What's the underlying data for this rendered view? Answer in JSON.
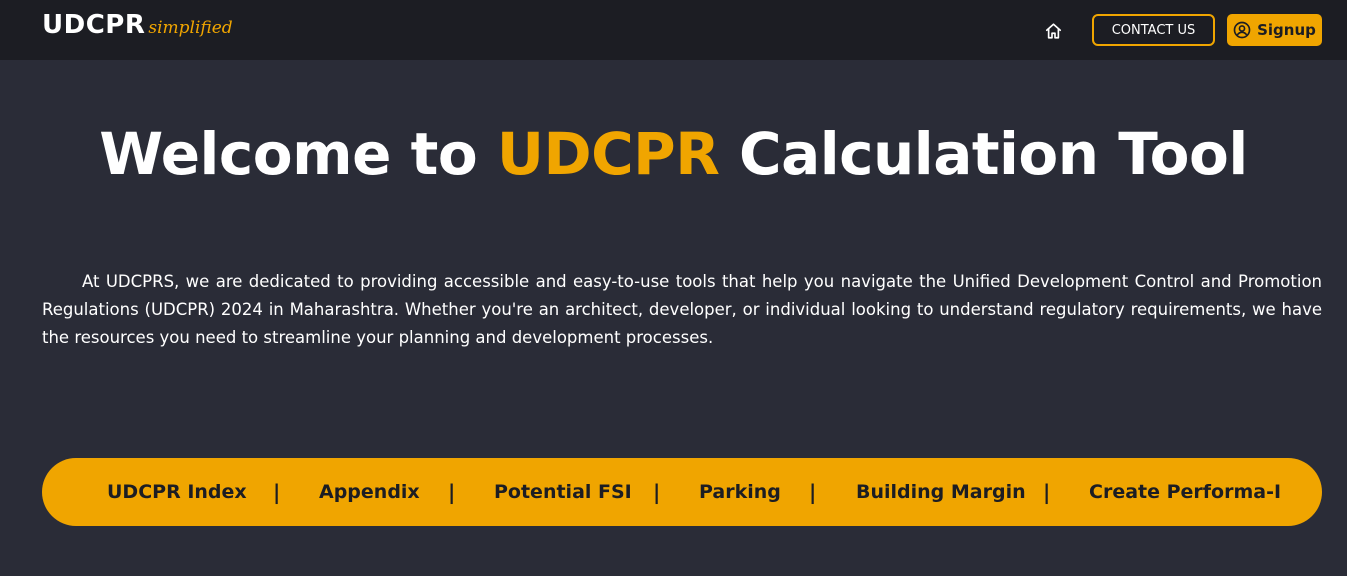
{
  "navbar": {
    "brand_main": "UDCPR",
    "brand_sub": "simplified",
    "home_icon": "home-icon",
    "contact_label": "CONTACT US",
    "signup_label": "Signup",
    "signup_icon": "user-circle-icon",
    "accent_color": "#f0a500"
  },
  "hero": {
    "title_prefix": "Welcome to ",
    "title_accent": "UDCPR",
    "title_suffix": " Calculation Tool"
  },
  "intro": {
    "text": "At UDCPRS, we are dedicated to providing accessible and easy-to-use tools that help you navigate the Unified Development Control and Promotion Regulations (UDCPR) 2024 in Maharashtra. Whether you're an architect, developer, or individual looking to understand regulatory requirements, we have the resources you need to streamline your planning and development processes."
  },
  "tools": {
    "items": [
      {
        "label": "UDCPR Index"
      },
      {
        "label": "Appendix"
      },
      {
        "label": "Potential FSI"
      },
      {
        "label": "Parking"
      },
      {
        "label": "Building Margin"
      },
      {
        "label": "Create Performa-I"
      }
    ],
    "separator": "|"
  }
}
